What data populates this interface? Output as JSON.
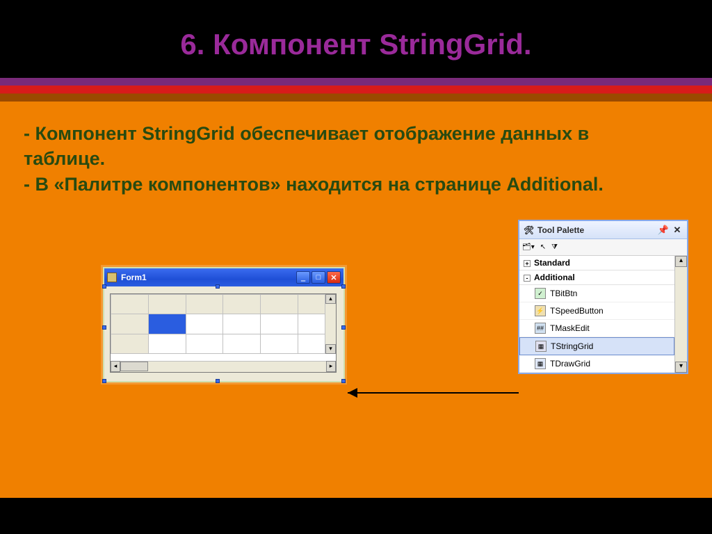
{
  "title": "6. Компонент StringGrid.",
  "body_line1": "- Компонент StringGrid обеспечивает отображение данных в таблице.",
  "body_line2": "- В «Палитре компонентов» находится на странице Additional.",
  "form": {
    "title": "Form1"
  },
  "palette": {
    "title": "Tool Palette",
    "categories": {
      "standard": {
        "label": "Standard",
        "expanded": false
      },
      "additional": {
        "label": "Additional",
        "expanded": true
      }
    },
    "items": [
      {
        "label": "TBitBtn"
      },
      {
        "label": "TSpeedButton"
      },
      {
        "label": "TMaskEdit"
      },
      {
        "label": "TStringGrid"
      },
      {
        "label": "TDrawGrid"
      }
    ]
  }
}
